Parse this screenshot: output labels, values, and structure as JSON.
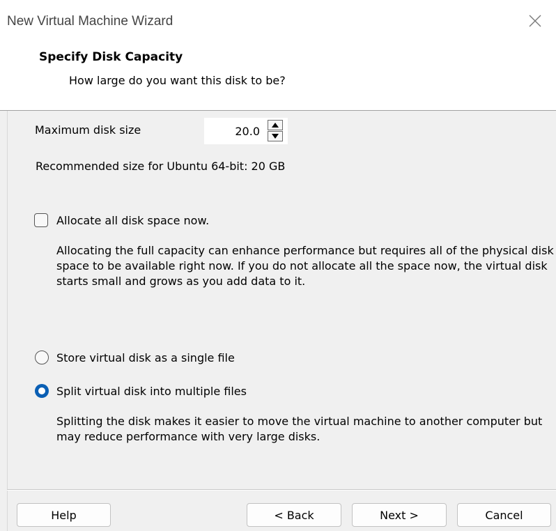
{
  "window": {
    "title": "New Virtual Machine Wizard"
  },
  "header": {
    "title": "Specify Disk Capacity",
    "subtitle": "How large do you want this disk to be?"
  },
  "disk_size": {
    "label": "Maximum disk size",
    "value": "20.0",
    "recommended": "Recommended size for Ubuntu 64-bit: 20 GB"
  },
  "allocate": {
    "label": "Allocate all disk space now.",
    "checked": false,
    "description": "Allocating the full capacity can enhance performance but requires all of the physical disk space to be available right now. If you do not allocate all the space now, the virtual disk starts small and grows as you add data to it."
  },
  "storage": {
    "options": [
      {
        "label": "Store virtual disk as a single file",
        "selected": false
      },
      {
        "label": "Split virtual disk into multiple files",
        "selected": true
      }
    ],
    "split_description": "Splitting the disk makes it easier to move the virtual machine to another computer but may reduce performance with very large disks."
  },
  "footer": {
    "help": "Help",
    "back": "< Back",
    "next": "Next >",
    "cancel": "Cancel"
  },
  "colors": {
    "accent": "#0a5fb4",
    "window_bg": "#f0f0f0"
  },
  "icons": [
    "close-icon",
    "spin-up-icon",
    "spin-down-icon"
  ]
}
